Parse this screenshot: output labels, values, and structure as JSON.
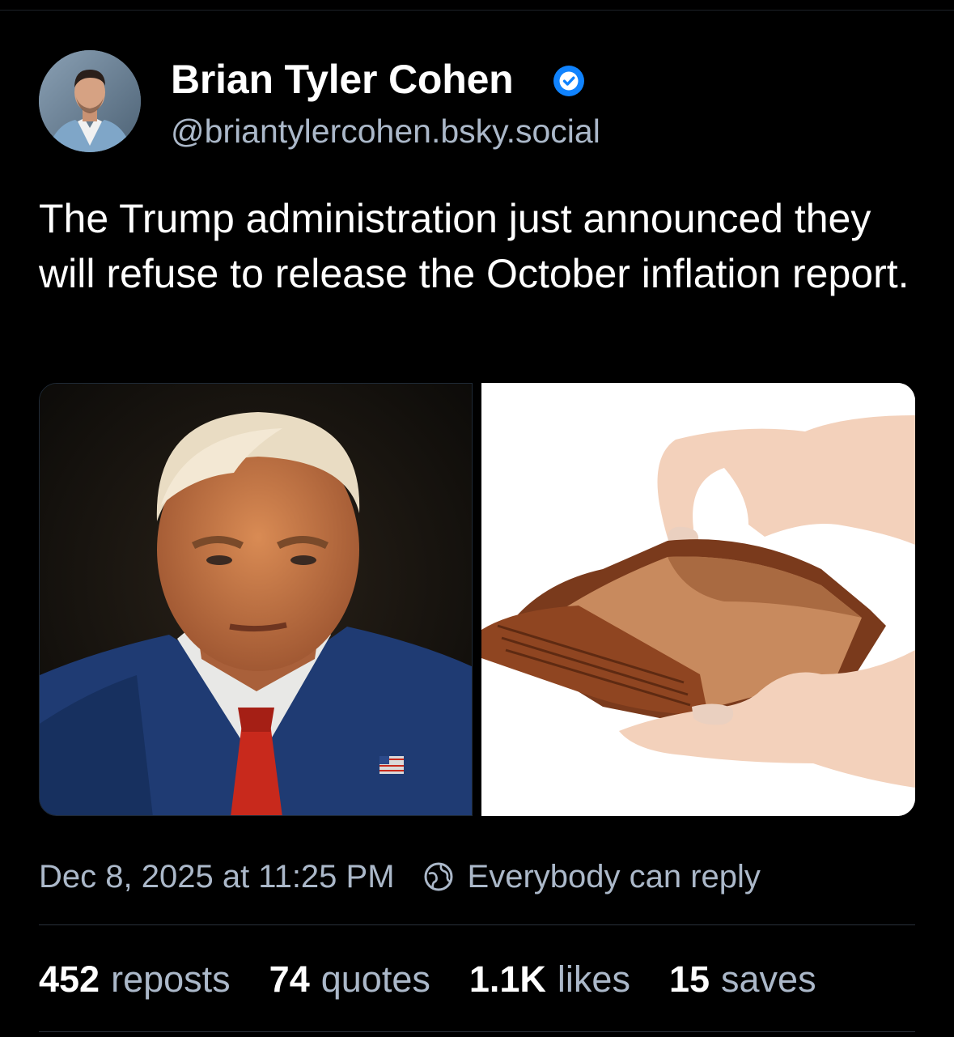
{
  "author": {
    "name": "Brian Tyler Cohen",
    "handle": "@briantylercohen.bsky.social",
    "verified": true,
    "badge_color": "#1083fe"
  },
  "post": {
    "text": "The Trump administration just announced they will refuse to release the October inflation report.",
    "images": [
      {
        "icon": "portrait-photo"
      },
      {
        "icon": "empty-wallet-photo"
      }
    ],
    "timestamp": "Dec 8, 2025 at 11:25 PM",
    "reply_setting": "Everybody can reply"
  },
  "stats": [
    {
      "count": "452",
      "label": "reposts"
    },
    {
      "count": "74",
      "label": "quotes"
    },
    {
      "count": "1.1K",
      "label": "likes"
    },
    {
      "count": "15",
      "label": "saves"
    }
  ],
  "colors": {
    "background": "#000000",
    "text_primary": "#ffffff",
    "text_secondary": "#abb8c9",
    "divider": "#2a313b"
  }
}
